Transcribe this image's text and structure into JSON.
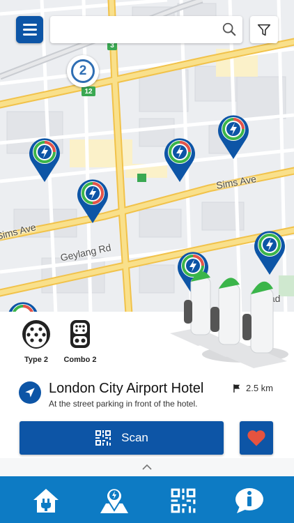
{
  "search": {
    "value": "",
    "placeholder": ""
  },
  "map": {
    "street_labels": [
      "Sims Ave",
      "Sims Ave",
      "Geylang Rd",
      "Road"
    ],
    "route_badges": [
      "3",
      "12"
    ],
    "cluster_count": "2"
  },
  "station": {
    "connectors": [
      {
        "icon": "type2-plug-icon",
        "label": "Type 2"
      },
      {
        "icon": "combo2-plug-icon",
        "label": "Combo 2"
      }
    ],
    "title": "London City Airport Hotel",
    "subtitle": "At the street parking in front of the hotel.",
    "distance": "2.5 km",
    "scan_label": "Scan"
  },
  "nav": {
    "items": [
      "home-plug-icon",
      "map-charger-icon",
      "qr-code-icon",
      "info-icon"
    ]
  },
  "colors": {
    "primary": "#0d55a6",
    "nav_bg": "#0d7bc4",
    "road_yellow": "#f7d66b",
    "pin_green": "#3bb54a",
    "pin_red": "#e5534b",
    "heart": "#e5533f"
  }
}
